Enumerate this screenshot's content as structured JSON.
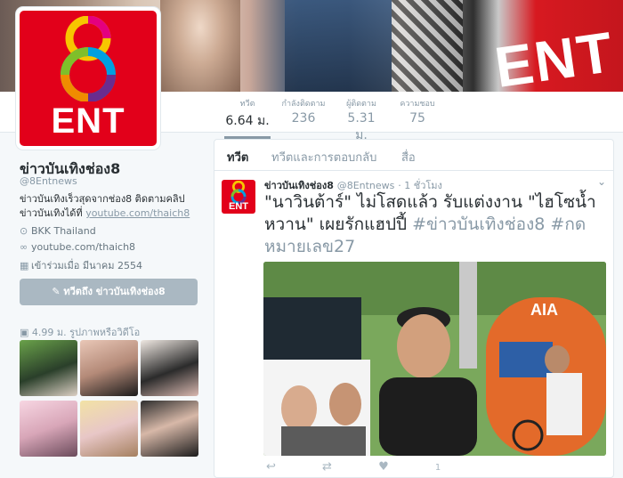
{
  "profile": {
    "name": "ข่าวบันเทิงช่อง8",
    "handle": "@8Entnews",
    "bio_text": "ข่าวบันเทิงเร็วสุดจากช่อง8 ติดตามคลิปข่าวบันเทิงได้ที่ ",
    "bio_link": "youtube.com/thaich8",
    "location": "BKK Thailand",
    "website": "youtube.com/thaich8",
    "joined": "เข้าร่วมเมื่อ มีนาคม 2554",
    "avatar_text": "ENT",
    "tweet_to_label": "ทวีตถึง ข่าวบันเทิงช่อง8",
    "photos_label": "4.99 ม. รูปภาพหรือวิดีโอ"
  },
  "banner": {
    "logo_text": "ENT"
  },
  "stats": [
    {
      "label": "ทวีต",
      "value": "6.64 ม."
    },
    {
      "label": "กำลังติดตาม",
      "value": "236"
    },
    {
      "label": "ผู้ติดตาม",
      "value": "5.31 ม."
    },
    {
      "label": "ความชอบ",
      "value": "75"
    }
  ],
  "timeline": {
    "tabs": [
      "ทวีต",
      "ทวีตและการตอบกลับ",
      "สื่อ"
    ],
    "tweet": {
      "author": "ข่าวบันเทิงช่อง8",
      "handle": "@8Entnews",
      "time": "· 1 ชั่วโมง",
      "text": "\"นาวินต้าร์\" ไม่โสดแล้ว รับแต่งงาน \"ไฮโซน้ำหวาน\" เผยรักแฮปปี้ ",
      "hashtags": "#ข่าวบันเทิงช่อง8 #กดหมายเลข27",
      "avatar_text": "ENT",
      "photo_sign": "AIA",
      "like_count": "1"
    }
  },
  "colors": {
    "brand": "#e2001a",
    "muted": "#8899a6",
    "text": "#292f33"
  }
}
